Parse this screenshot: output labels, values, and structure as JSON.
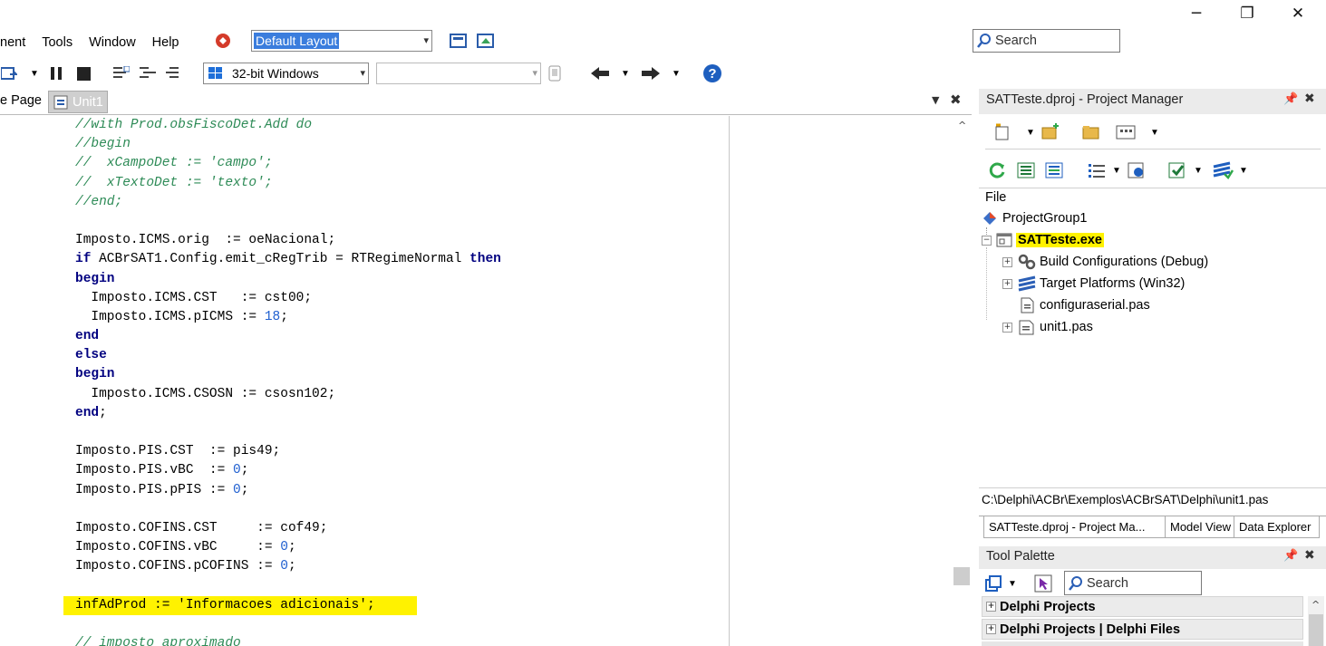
{
  "window": {
    "minimize_glyph": "─",
    "restore_glyph": "❐",
    "close_glyph": "✕"
  },
  "menu": {
    "items": [
      "nent",
      "Tools",
      "Window",
      "Help"
    ]
  },
  "layout_combo": {
    "value": "Default Layout"
  },
  "global_search": {
    "placeholder": "Search"
  },
  "toolbar2": {
    "platform": "32-bit Windows",
    "config_value": ""
  },
  "editor": {
    "tabs": [
      "e Page",
      "Unit1"
    ],
    "lines": [
      [
        [
          "cm",
          "//with Prod.obsFiscoDet.Add do"
        ]
      ],
      [
        [
          "cm",
          "//begin"
        ]
      ],
      [
        [
          "cm",
          "//  xCampoDet := 'campo';"
        ]
      ],
      [
        [
          "cm",
          "//  xTextoDet := 'texto';"
        ]
      ],
      [
        [
          "cm",
          "//end;"
        ]
      ],
      [],
      [
        [
          "",
          "Imposto.ICMS.orig  := oeNacional;"
        ]
      ],
      [
        [
          "kw",
          "if"
        ],
        [
          "",
          " ACBrSAT1.Config.emit_cRegTrib = RTRegimeNormal "
        ],
        [
          "kw",
          "then"
        ]
      ],
      [
        [
          "kw",
          "begin"
        ]
      ],
      [
        [
          "",
          "  Imposto.ICMS.CST   := cst00;"
        ]
      ],
      [
        [
          "",
          "  Imposto.ICMS.pICMS := "
        ],
        [
          "nm",
          "18"
        ],
        [
          "",
          ";"
        ]
      ],
      [
        [
          "kw",
          "end"
        ]
      ],
      [
        [
          "kw",
          "else"
        ]
      ],
      [
        [
          "kw",
          "begin"
        ]
      ],
      [
        [
          "",
          "  Imposto.ICMS.CSOSN := csosn102;"
        ]
      ],
      [
        [
          "kw",
          "end"
        ],
        [
          "",
          ";"
        ]
      ],
      [],
      [
        [
          "",
          "Imposto.PIS.CST  := pis49;"
        ]
      ],
      [
        [
          "",
          "Imposto.PIS.vBC  := "
        ],
        [
          "nm",
          "0"
        ],
        [
          "",
          ";"
        ]
      ],
      [
        [
          "",
          "Imposto.PIS.pPIS := "
        ],
        [
          "nm",
          "0"
        ],
        [
          "",
          ";"
        ]
      ],
      [],
      [
        [
          "",
          "Imposto.COFINS.CST     := cof49;"
        ]
      ],
      [
        [
          "",
          "Imposto.COFINS.vBC     := "
        ],
        [
          "nm",
          "0"
        ],
        [
          "",
          ";"
        ]
      ],
      [
        [
          "",
          "Imposto.COFINS.pCOFINS := "
        ],
        [
          "nm",
          "0"
        ],
        [
          "",
          ";"
        ]
      ],
      [],
      [
        [
          "hl",
          "infAdProd := "
        ],
        [
          "hlst",
          "'Informacoes adicionais'"
        ],
        [
          "hl",
          ";"
        ]
      ],
      [],
      [
        [
          "cm",
          "// imposto aproximado"
        ]
      ]
    ]
  },
  "project_manager": {
    "title": "SATTeste.dproj - Project Manager",
    "file_label": "File",
    "tree": [
      {
        "label": "ProjectGroup1"
      },
      {
        "label": "SATTeste.exe"
      },
      {
        "label": "Build Configurations (Debug)"
      },
      {
        "label": "Target Platforms (Win32)"
      },
      {
        "label": "configuraserial.pas"
      },
      {
        "label": "unit1.pas"
      }
    ],
    "path": "C:\\Delphi\\ACBr\\Exemplos\\ACBrSAT\\Delphi\\unit1.pas",
    "tabs": [
      "SATTeste.dproj - Project Ma...",
      "Model View",
      "Data Explorer"
    ]
  },
  "tool_palette": {
    "title": "Tool Palette",
    "search_placeholder": "Search",
    "categories": [
      "Delphi Projects",
      "Delphi Projects | Delphi Files"
    ]
  },
  "colors": {
    "highlight": "#fff200",
    "comment": "#2e8b57",
    "keyword": "#000080",
    "number": "#1f5fd0"
  }
}
